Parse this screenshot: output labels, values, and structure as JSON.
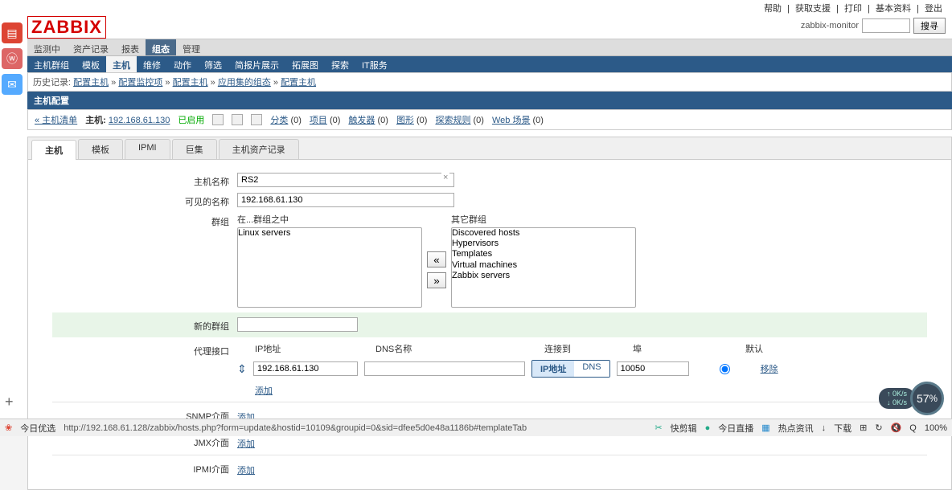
{
  "top_links": [
    "帮助",
    "获取支援",
    "打印",
    "基本资料",
    "登出"
  ],
  "logo": "ZABBIX",
  "server_name": "zabbix-monitor",
  "search_btn": "搜寻",
  "main_nav": [
    "监测中",
    "资产记录",
    "报表",
    "组态",
    "管理"
  ],
  "main_nav_sel": 3,
  "sub_nav": [
    "主机群组",
    "模板",
    "主机",
    "维修",
    "动作",
    "筛选",
    "简报片展示",
    "拓展图",
    "探索",
    "IT服务"
  ],
  "sub_nav_sel": 2,
  "breadcrumb": {
    "label": "历史记录:",
    "items": [
      "配置主机",
      "配置监控项",
      "配置主机",
      "应用集的组态",
      "配置主机"
    ]
  },
  "titlebar": "主机配置",
  "infobar": {
    "list_link": "« 主机清单",
    "host_label": "主机:",
    "host_ip": "192.168.61.130",
    "enabled": "已启用",
    "links": [
      [
        "分类",
        "(0)"
      ],
      [
        "项目",
        "(0)"
      ],
      [
        "触发器",
        "(0)"
      ],
      [
        "图形",
        "(0)"
      ],
      [
        "探索规则",
        "(0)"
      ],
      [
        "Web 场景",
        "(0)"
      ]
    ]
  },
  "tabs": [
    "主机",
    "模板",
    "IPMI",
    "巨集",
    "主机资产记录"
  ],
  "tabs_sel": 0,
  "form": {
    "name_label": "主机名称",
    "name_value": "RS2",
    "visible_label": "可见的名称",
    "visible_value": "192.168.61.130",
    "groups_label": "群组",
    "in_groups_label": "在...群组之中",
    "other_groups_label": "其它群组",
    "in_groups": [
      "Linux servers"
    ],
    "other_groups": [
      "Discovered hosts",
      "Hypervisors",
      "Templates",
      "Virtual machines",
      "Zabbix servers"
    ],
    "new_group_label": "新的群组",
    "proxy_label": "代理接口",
    "iface_headers": {
      "ip": "IP地址",
      "dns": "DNS名称",
      "connect": "连接到",
      "port": "埠",
      "default": "默认"
    },
    "iface_ip": "192.168.61.130",
    "iface_dns": "",
    "iface_port": "10050",
    "connect_ip": "IP地址",
    "connect_dns": "DNS",
    "add": "添加",
    "remove": "移除",
    "snmp_label": "SNMP介面",
    "jmx_label": "JMX介面",
    "ipmi_label": "IPMI介面"
  },
  "status": {
    "today": "今日优选",
    "url": "http://192.168.61.128/zabbix/hosts.php?form=update&hostid=10109&groupid=0&sid=dfee5d0e48a1186b#templateTab",
    "links": [
      "快剪辑",
      "今日直播",
      "热点资讯",
      "下载"
    ],
    "zoom": "100%",
    "speed_up": "0K/s",
    "speed_dn": "0K/s",
    "pct": "57"
  }
}
